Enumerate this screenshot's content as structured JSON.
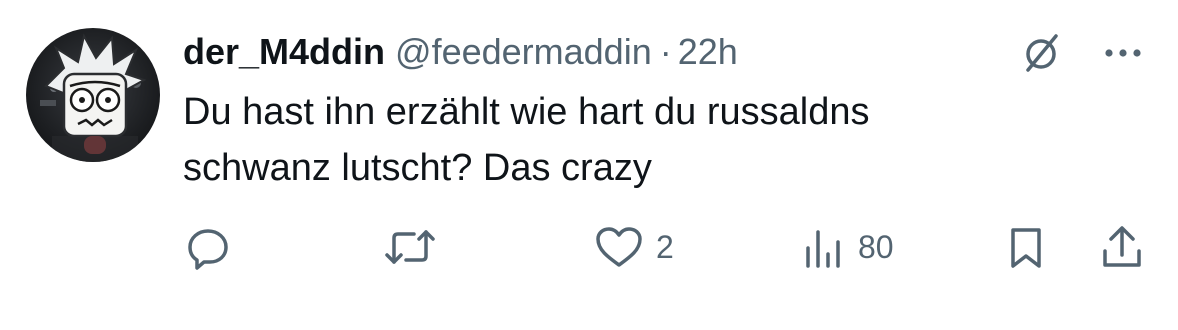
{
  "tweet": {
    "author": {
      "display_name": "der_M4ddin",
      "handle": "@feedermaddin",
      "avatar_icon": "cartoon-face-avatar"
    },
    "separator": "·",
    "time": "22h",
    "text_line1": "Du hast ihn erzählt wie hart du russaldns",
    "text_line2": "schwanz lutscht? Das crazy",
    "actions": {
      "reply_count": "",
      "retweet_count": "",
      "like_count": "2",
      "views_count": "80"
    },
    "icons": {
      "grok": "grok-slash-circle-icon",
      "more": "more-dots-icon",
      "reply": "reply-bubble-icon",
      "retweet": "retweet-arrows-icon",
      "like": "heart-icon",
      "views": "views-bars-icon",
      "bookmark": "bookmark-icon",
      "share": "share-upload-icon"
    },
    "colors": {
      "text": "#0f1419",
      "secondary": "#536471"
    }
  }
}
